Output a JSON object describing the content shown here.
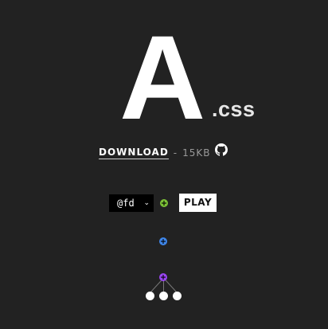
{
  "logo": {
    "letter": "A",
    "extension": ".css"
  },
  "download": {
    "label": "DOWNLOAD",
    "separator": "-",
    "size": "15KB"
  },
  "github": {
    "icon": "github-icon"
  },
  "controls": {
    "select_value": "@fd",
    "play_label": "PLAY"
  },
  "colors": {
    "background": "#222222",
    "green_dot": "#7cc137",
    "blue_dot": "#3f86e9",
    "purple_dot": "#9a45f2",
    "leaf": "#ffffff"
  }
}
